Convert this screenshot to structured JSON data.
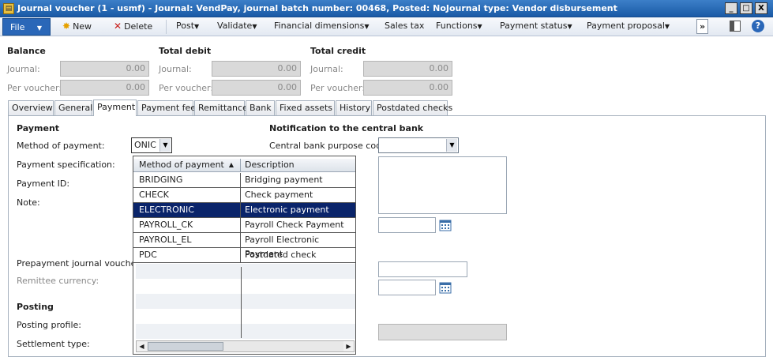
{
  "window": {
    "title": "Journal voucher (1 - usmf) - Journal: VendPay, journal batch number: 00468, Posted: NoJournal type: Vendor disbursement",
    "app_icon": "journal-app-icon",
    "controls": {
      "minimize": "_",
      "maximize": "□",
      "close": "X"
    }
  },
  "toolbar": {
    "file_label": "File",
    "new_label": "New",
    "delete_label": "Delete",
    "post_label": "Post",
    "validate_label": "Validate",
    "financial_dimensions_label": "Financial dimensions",
    "sales_tax_label": "Sales tax",
    "functions_label": "Functions",
    "payment_status_label": "Payment status",
    "payment_proposal_label": "Payment proposal",
    "overflow_label": "»",
    "help_label": "?"
  },
  "balance": {
    "header": "Balance",
    "journal_label": "Journal:",
    "journal_value": "0.00",
    "per_voucher_label": "Per voucher:",
    "per_voucher_value": "0.00"
  },
  "total_debit": {
    "header": "Total debit",
    "journal_label": "Journal:",
    "journal_value": "0.00",
    "per_voucher_label": "Per voucher:",
    "per_voucher_value": "0.00"
  },
  "total_credit": {
    "header": "Total credit",
    "journal_label": "Journal:",
    "journal_value": "0.00",
    "per_voucher_label": "Per voucher:",
    "per_voucher_value": "0.00"
  },
  "tabs": [
    "Overview",
    "General",
    "Payment",
    "Payment fee",
    "Remittance",
    "Bank",
    "Fixed assets",
    "History",
    "Postdated checks"
  ],
  "active_tab": "Payment",
  "payment": {
    "header": "Payment",
    "method_label": "Method of payment:",
    "method_value": "ONIC",
    "specification_label": "Payment specification:",
    "payment_id_label": "Payment ID:",
    "note_label": "Note:",
    "prepayment_label": "Prepayment journal voucher:",
    "remittee_currency_label": "Remittee currency:"
  },
  "posting": {
    "header": "Posting",
    "profile_label": "Posting profile:",
    "settlement_label": "Settlement type:"
  },
  "notification": {
    "header": "Notification to the central bank",
    "purpose_code_label": "Central bank purpose code:",
    "purpose_code_value": ""
  },
  "dropdown": {
    "col_method": "Method of payment",
    "col_description": "Description",
    "sort_indicator": "▲",
    "rows": [
      {
        "method": "BRIDGING",
        "description": "Bridging payment"
      },
      {
        "method": "CHECK",
        "description": "Check payment"
      },
      {
        "method": "ELECTRONIC",
        "description": "Electronic payment"
      },
      {
        "method": "PAYROLL_CK",
        "description": "Payroll Check Payment"
      },
      {
        "method": "PAYROLL_EL",
        "description": "Payroll Electronic Payment"
      },
      {
        "method": "PDC",
        "description": "Postdated check"
      }
    ],
    "selected": "ELECTRONIC"
  }
}
